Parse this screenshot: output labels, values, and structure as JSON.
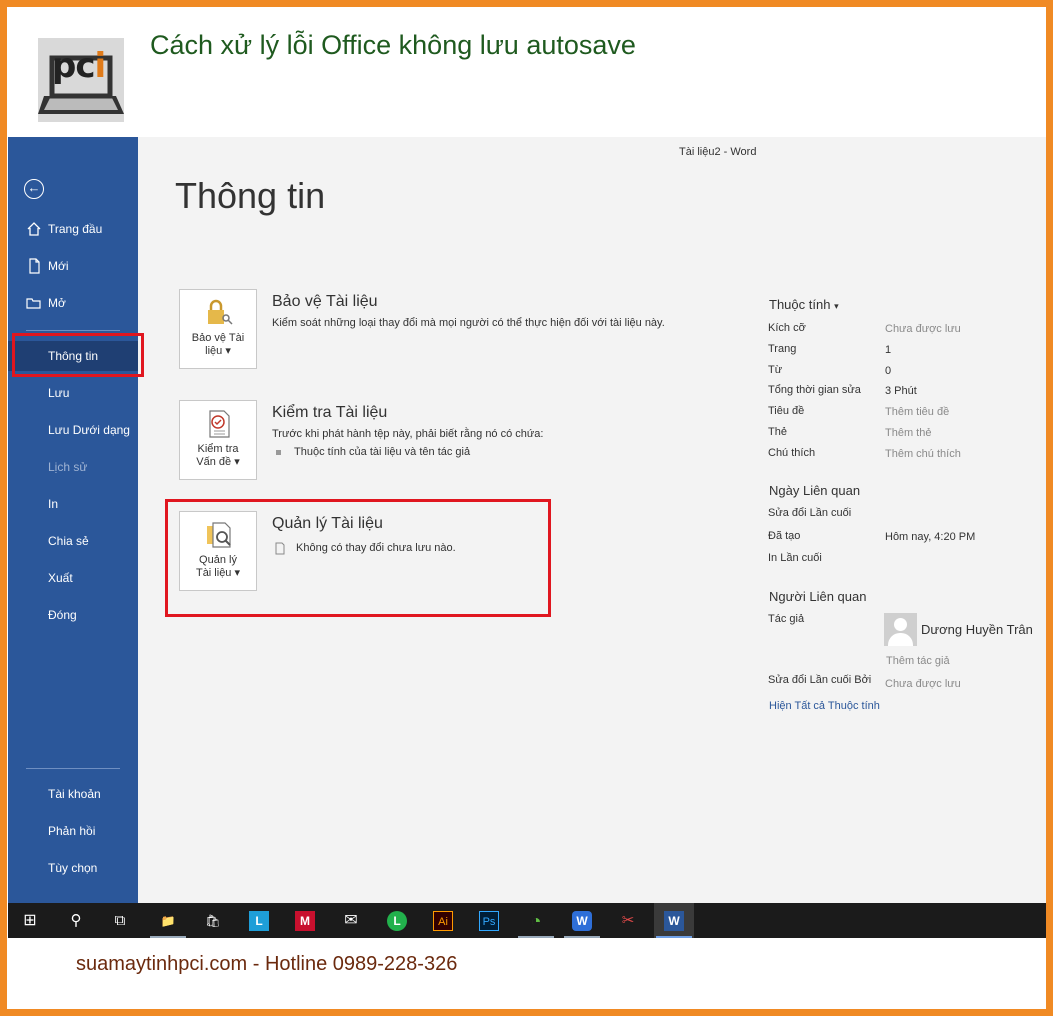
{
  "article": {
    "title": "Cách xử lý lỗi Office không lưu autosave",
    "logo_text": "pci",
    "footer": "suamaytinhpci.com - Hotline 0989-228-326"
  },
  "window": {
    "title": "Tài liệu2  -  Word"
  },
  "sidebar": {
    "back_icon": "back-arrow-icon",
    "items": [
      {
        "label": "Trang đầu",
        "icon": "home-icon"
      },
      {
        "label": "Mới",
        "icon": "new-document-icon"
      },
      {
        "label": "Mở",
        "icon": "open-folder-icon"
      },
      {
        "label": "Thông tin"
      },
      {
        "label": "Lưu"
      },
      {
        "label": "Lưu Dưới dạng"
      },
      {
        "label": "Lịch sử"
      },
      {
        "label": "In"
      },
      {
        "label": "Chia sẻ"
      },
      {
        "label": "Xuất"
      },
      {
        "label": "Đóng"
      },
      {
        "label": "Tài khoản"
      },
      {
        "label": "Phản hồi"
      },
      {
        "label": "Tùy chọn"
      }
    ],
    "active": "Thông tin",
    "active_color": "#1f3f73",
    "accent_color": "#2b579a",
    "highlight_color": "#e0161f"
  },
  "main": {
    "heading": "Thông tin",
    "sections": [
      {
        "tile_label_1": "Bảo vệ Tài",
        "tile_label_2": "liệu",
        "icon": "lock-key-icon",
        "title": "Bảo vệ Tài liệu",
        "desc": "Kiểm soát những loại thay đổi mà mọi người có thể thực hiện đối với tài liệu này."
      },
      {
        "tile_label_1": "Kiểm tra",
        "tile_label_2": "Vấn đề",
        "icon": "checklist-icon",
        "title": "Kiểm tra Tài liệu",
        "desc": "Trước khi phát hành tệp này, phải biết rằng nó có chứa:",
        "bullet": "Thuộc tính của tài liệu và tên tác giả"
      },
      {
        "tile_label_1": "Quản lý",
        "tile_label_2": "Tài liệu",
        "icon": "manage-document-icon",
        "title": "Quản lý Tài liệu",
        "desc": "Không có thay đổi chưa lưu nào."
      }
    ]
  },
  "properties": {
    "heading": "Thuộc tính",
    "rows": [
      {
        "key": "Kích cỡ",
        "value": "Chưa được lưu"
      },
      {
        "key": "Trang",
        "value": "1"
      },
      {
        "key": "Từ",
        "value": "0"
      },
      {
        "key": "Tổng thời gian sửa",
        "value": "3 Phút"
      },
      {
        "key": "Tiêu đề",
        "value": "Thêm tiêu đề"
      },
      {
        "key": "Thẻ",
        "value": "Thêm thẻ"
      },
      {
        "key": "Chú thích",
        "value": "Thêm chú thích"
      }
    ],
    "dates_heading": "Ngày Liên quan",
    "dates": [
      {
        "key": "Sửa đổi Lần cuối",
        "value": ""
      },
      {
        "key": "Đã tạo",
        "value": "Hôm nay, 4:20 PM"
      },
      {
        "key": "In Lần cuối",
        "value": ""
      }
    ],
    "people_heading": "Người Liên quan",
    "author_key": "Tác giả",
    "author_name": "Dương Huyền Trân",
    "add_author": "Thêm tác giả",
    "last_modified_by_key": "Sửa đổi Lần cuối Bởi",
    "last_modified_by_value": "Chưa được lưu",
    "show_all": "Hiện Tất cả Thuộc tính"
  },
  "taskbar": {
    "items": [
      {
        "name": "windows-start-icon",
        "glyph": "⊞"
      },
      {
        "name": "search-icon",
        "glyph": "⚲"
      },
      {
        "name": "task-view-icon",
        "glyph": "⧉"
      },
      {
        "name": "file-explorer-icon",
        "glyph": "📁",
        "color": "#f2c14e"
      },
      {
        "name": "store-icon",
        "glyph": "🛍",
        "color": "#ffffff"
      },
      {
        "name": "l-app-icon",
        "glyph": "L",
        "color": "#1e9ed8"
      },
      {
        "name": "mcafee-icon",
        "glyph": "M",
        "color": "#c8102e"
      },
      {
        "name": "mail-icon",
        "glyph": "✉",
        "color": "#ffffff"
      },
      {
        "name": "line-icon",
        "glyph": "L",
        "color": "#22b14c"
      },
      {
        "name": "illustrator-icon",
        "glyph": "Ai",
        "color": "#ff9a00"
      },
      {
        "name": "photoshop-icon",
        "glyph": "Ps",
        "color": "#31a8ff"
      },
      {
        "name": "chart-app-icon",
        "glyph": "◔",
        "color": "#62c245"
      },
      {
        "name": "wps-icon",
        "glyph": "W",
        "color": "#2f6fd8"
      },
      {
        "name": "snipping-tool-icon",
        "glyph": "✂",
        "color": "#e24a4a"
      },
      {
        "name": "word-icon",
        "glyph": "W",
        "color": "#2b579a"
      }
    ]
  }
}
